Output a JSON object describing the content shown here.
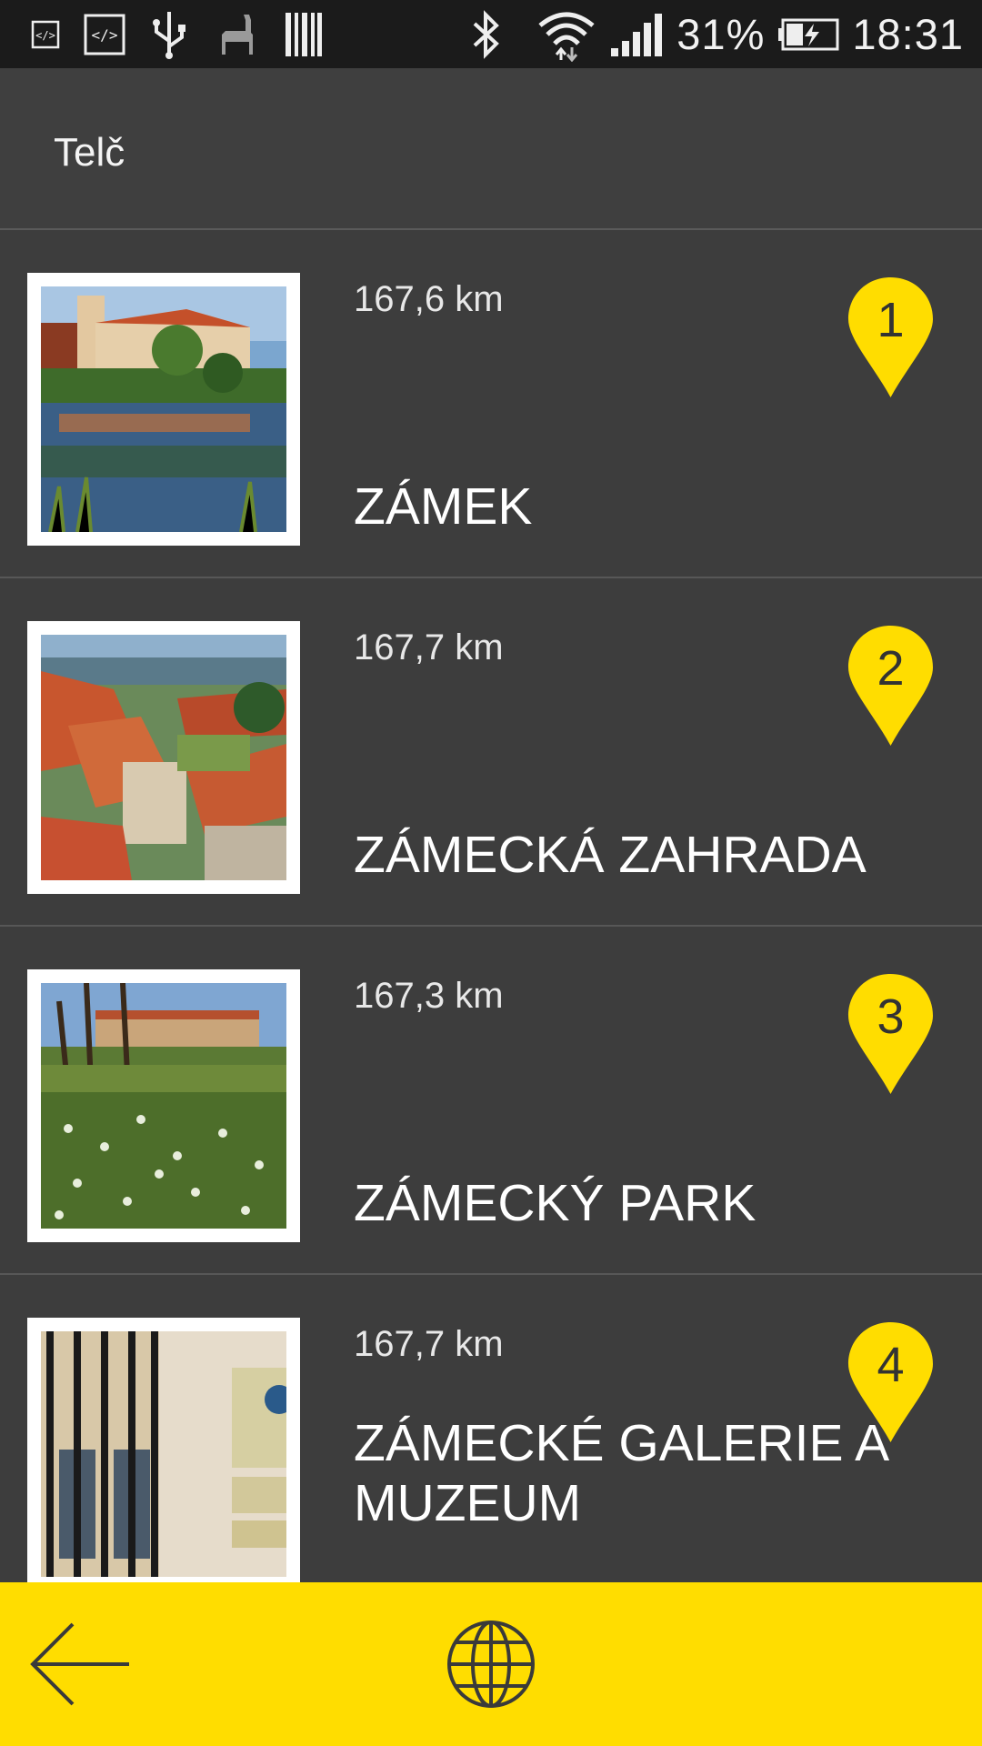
{
  "status_bar": {
    "battery": "31%",
    "time": "18:31",
    "icons_left": [
      "code-icon",
      "code-box-icon",
      "usb-icon",
      "llama-icon",
      "barcode-icon"
    ],
    "icons_right": [
      "bluetooth-icon",
      "wifi-icon",
      "signal-icon",
      "battery-charging-icon"
    ]
  },
  "header": {
    "title": "Telč"
  },
  "places": [
    {
      "distance": "167,6 km",
      "name": "ZÁMEK",
      "number": "1"
    },
    {
      "distance": "167,7 km",
      "name": "ZÁMECKÁ ZAHRADA",
      "number": "2"
    },
    {
      "distance": "167,3 km",
      "name": "ZÁMECKÝ PARK",
      "number": "3"
    },
    {
      "distance": "167,7 km",
      "name": "ZÁMECKÉ GALERIE A MUZEUM",
      "number": "4"
    }
  ],
  "bottom_bar": {
    "icons": [
      "back-arrow-icon",
      "globe-icon"
    ]
  },
  "colors": {
    "accent": "#ffdd00",
    "background": "#3d3d3d",
    "status_bar": "#1b1b1b"
  }
}
